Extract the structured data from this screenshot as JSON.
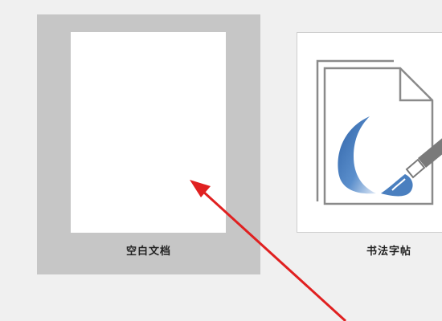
{
  "templates": [
    {
      "label": "空白文档",
      "selected": true
    },
    {
      "label": "书法字帖",
      "selected": false
    }
  ],
  "colors": {
    "background": "#f0f0f0",
    "selected_card": "#c6c6c6",
    "annotation_arrow": "#e02020",
    "brush_blue": "#4a7fbf"
  },
  "icons": [
    "calligraphy-document-icon",
    "annotation-arrow"
  ]
}
